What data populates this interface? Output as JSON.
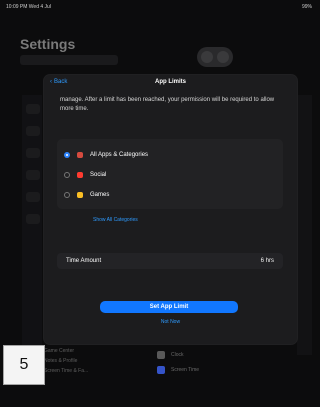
{
  "status_bar": {
    "left": "10:09 PM Wed 4 Jul",
    "right": "99%"
  },
  "background": {
    "title": "Settings",
    "bottom_left_items": [
      "Game Center",
      "Notes & Profile",
      "Screen Time & Fa..."
    ],
    "bottom_right_items": [
      {
        "label": "Clock",
        "icon": "clock-icon"
      },
      {
        "label": "Screen Time",
        "icon": "hourglass-icon"
      }
    ]
  },
  "modal": {
    "back_label": "Back",
    "title": "App Limits",
    "description": "manage. After a limit has been reached, your permission will be required to allow more time.",
    "options": [
      {
        "label": "All Apps & Categories",
        "selected": true,
        "icon": "all-apps-icon",
        "icon_color": "#d64b3f"
      },
      {
        "label": "Social",
        "selected": false,
        "icon": "social-icon",
        "icon_color": "#ff3b30"
      },
      {
        "label": "Games",
        "selected": false,
        "icon": "games-icon",
        "icon_color": "#fbbf24"
      }
    ],
    "show_all": "Show All Categories",
    "time_amount_label": "Time Amount",
    "time_amount_value": "6 hrs",
    "set_button": "Set App Limit",
    "not_now": "Not Now"
  },
  "page_number": "5"
}
